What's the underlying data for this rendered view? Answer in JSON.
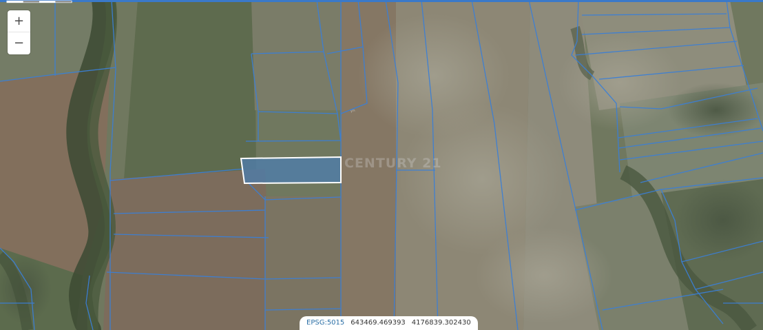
{
  "map": {
    "zoom_in_label": "+",
    "zoom_out_label": "−",
    "watermark": "CENTURY 21",
    "road_label": "ул.",
    "projection": "EPSG:5015",
    "coord_x": "643469.469393",
    "coord_y": "4176839.302430"
  },
  "colors": {
    "parcel_line": "#3b7fd6",
    "selected_parcel_fill": "#4f7ca8",
    "selected_parcel_outline": "#ffffff",
    "top_border": "#3a79c9"
  }
}
